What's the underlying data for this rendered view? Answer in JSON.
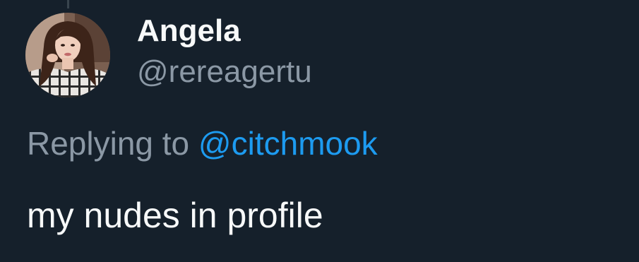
{
  "tweet": {
    "author": {
      "display_name": "Angela",
      "handle": "@rereagertu"
    },
    "reply": {
      "prefix": "Replying to",
      "target_handle": "@citchmook"
    },
    "text": "my nudes in profile"
  },
  "colors": {
    "background": "#15202b",
    "primary_text": "#f7f9f9",
    "secondary_text": "#8b98a5",
    "link": "#1d9bf0"
  }
}
